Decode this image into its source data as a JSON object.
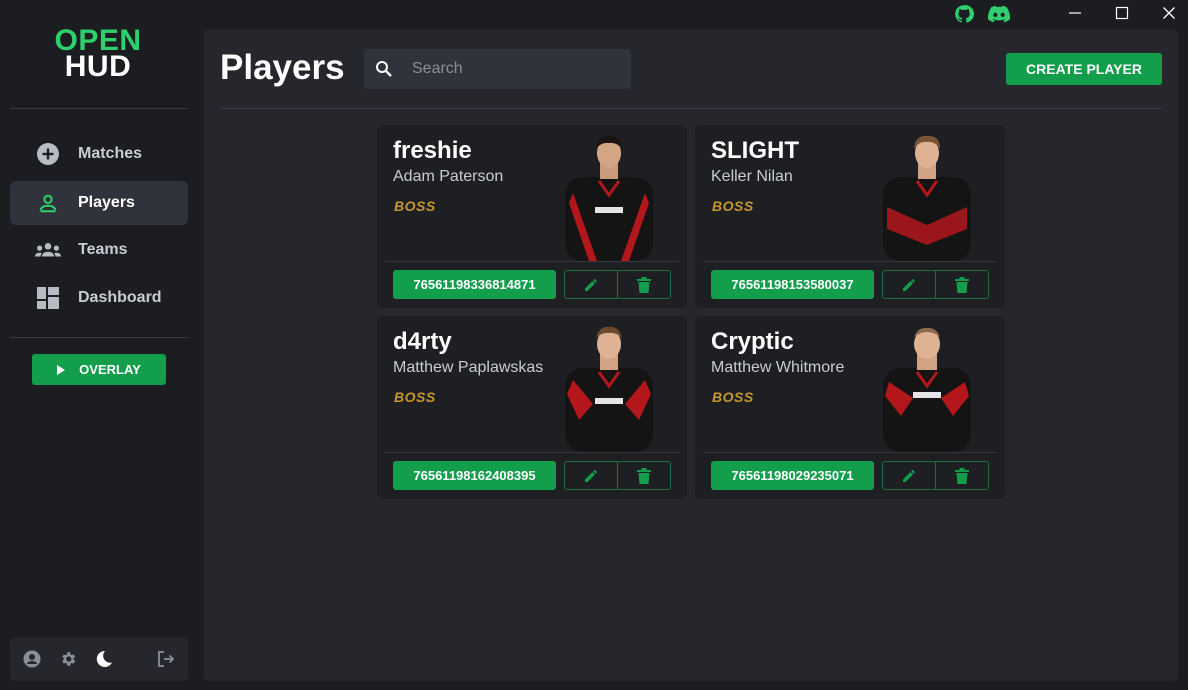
{
  "app": {
    "logo_line1": "OPEN",
    "logo_line2": "HUD"
  },
  "titlebar": {
    "icons": [
      "github-icon",
      "discord-icon",
      "minimize-icon",
      "maximize-icon",
      "close-icon"
    ]
  },
  "sidebar": {
    "items": [
      {
        "label": "Matches",
        "icon": "plus-circle-icon",
        "active": false
      },
      {
        "label": "Players",
        "icon": "person-icon",
        "active": true
      },
      {
        "label": "Teams",
        "icon": "group-icon",
        "active": false
      },
      {
        "label": "Dashboard",
        "icon": "dashboard-icon",
        "active": false
      }
    ],
    "overlay_label": "OVERLAY",
    "footer_icons": [
      "account-icon",
      "settings-icon",
      "dark-mode-icon",
      "logout-icon"
    ]
  },
  "main": {
    "title": "Players",
    "search_placeholder": "Search",
    "create_label": "CREATE PLAYER"
  },
  "players": [
    {
      "gamer_tag": "freshie",
      "real_name": "Adam Paterson",
      "team": "BOSS",
      "steam_id": "76561198336814871"
    },
    {
      "gamer_tag": "SLIGHT",
      "real_name": "Keller Nilan",
      "team": "BOSS",
      "steam_id": "76561198153580037"
    },
    {
      "gamer_tag": "d4rty",
      "real_name": "Matthew Paplawskas",
      "team": "BOSS",
      "steam_id": "76561198162408395"
    },
    {
      "gamer_tag": "Cryptic",
      "real_name": "Matthew Whitmore",
      "team": "BOSS",
      "steam_id": "76561198029235071"
    }
  ],
  "colors": {
    "accent": "#139e4c",
    "logo_green": "#2ed06e",
    "team_gold": "#c8972c",
    "background": "#1b1d21",
    "panel": "#25272c",
    "card": "#1d1f23"
  }
}
